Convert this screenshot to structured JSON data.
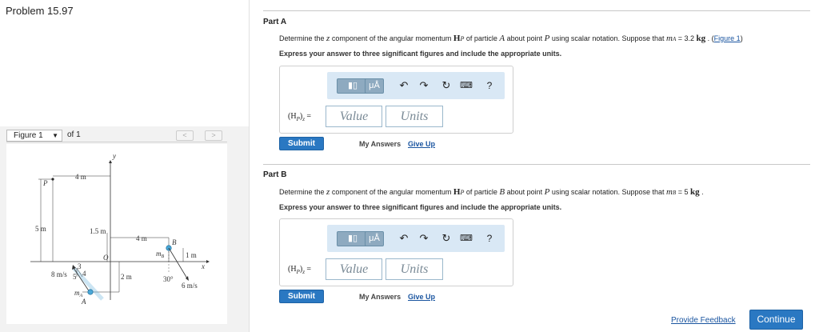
{
  "problem": {
    "title": "Problem 15.97"
  },
  "figure_nav": {
    "selected": "Figure 1",
    "of_label": "of 1",
    "prev": "<",
    "next": ">"
  },
  "diagram": {
    "labels": {
      "y": "y",
      "x": "x",
      "P": "P",
      "O": "O",
      "B": "B",
      "dim_4m_top": "4 m",
      "dim_5m": "5 m",
      "dim_1_5m": "1.5 m",
      "dim_4m_mid": "4 m",
      "dim_1m": "1 m",
      "dim_2m": "2 m",
      "mB": "m",
      "mB_sub": "B",
      "angle": "30°",
      "vB": "6 m/s",
      "vA": "8 m/s",
      "tri_3": "3",
      "tri_4": "4",
      "tri_5": "5",
      "mA": "m",
      "mA_sub": "A",
      "A": "A"
    }
  },
  "partA": {
    "label": "Part A",
    "prompt_1": "Determine the ",
    "prompt_z": "z",
    "prompt_2": " component of the angular momentum ",
    "prompt_H": "H",
    "prompt_Hsub": "P",
    "prompt_3": " of particle ",
    "prompt_particle": "A",
    "prompt_4": " about point ",
    "prompt_P": "P",
    "prompt_5": " using scalar notation. Suppose that ",
    "prompt_m": "m",
    "prompt_msub": "A",
    "prompt_6": " = 3.2 ",
    "prompt_kg": "kg",
    "prompt_7": " . (",
    "figure_link": "Figure 1",
    "prompt_8": ")",
    "instruction": "Express your answer to three significant figures and include the appropriate units.",
    "answer_label": "(H",
    "answer_sub": "P",
    "answer_tail": ")",
    "answer_z": "z",
    "answer_eq": " =",
    "value_placeholder": "Value",
    "units_placeholder": "Units",
    "submit": "Submit",
    "my_answers": "My Answers",
    "give_up": "Give Up"
  },
  "partB": {
    "label": "Part B",
    "prompt_1": "Determine the ",
    "prompt_z": "z",
    "prompt_2": " component of the angular momentum ",
    "prompt_H": "H",
    "prompt_Hsub": "P",
    "prompt_3": " of particle ",
    "prompt_particle": "B",
    "prompt_4": " about point ",
    "prompt_P": "P",
    "prompt_5": " using scalar notation. Suppose that ",
    "prompt_m": "m",
    "prompt_msub": "B",
    "prompt_6": " = 5 ",
    "prompt_kg": "kg",
    "prompt_7": " .",
    "instruction": "Express your answer to three significant figures and include the appropriate units.",
    "answer_label": "(H",
    "answer_sub": "P",
    "answer_tail": ")",
    "answer_z": "z",
    "answer_eq": " =",
    "value_placeholder": "Value",
    "units_placeholder": "Units",
    "submit": "Submit",
    "my_answers": "My Answers",
    "give_up": "Give Up"
  },
  "toolbar": {
    "templates_icon": "▮▯",
    "mu_label": "μÅ",
    "help": "?"
  },
  "footer": {
    "feedback": "Provide Feedback",
    "continue": "Continue"
  },
  "colors": {
    "accent": "#2a78c2",
    "toolbar_bg": "#d9e8f5",
    "particle": "#4aa8d8"
  }
}
